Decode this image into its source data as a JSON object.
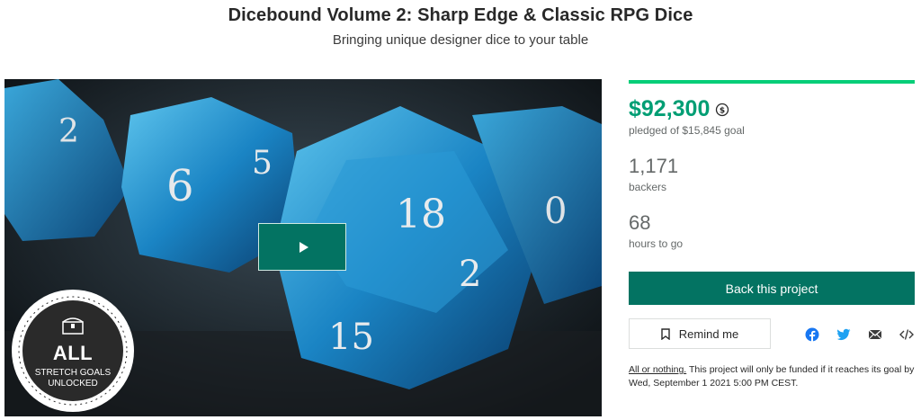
{
  "project": {
    "title": "Dicebound Volume 2: Sharp Edge & Classic RPG Dice",
    "subtitle": "Bringing unique designer dice to your table"
  },
  "media": {
    "play_icon": "play-icon",
    "badge": {
      "line1": "ALL",
      "line2": "STRETCH GOALS",
      "line3": "UNLOCKED",
      "icon": "treasure-chest-icon"
    }
  },
  "funding": {
    "pledged": "$92,300",
    "currency_icon": "currency-convert-icon",
    "goal_text": "pledged of $15,845 goal",
    "progress_fraction": 1.0,
    "progress_color": "#05ce78"
  },
  "stats": {
    "backers_count": "1,171",
    "backers_label": "backers",
    "hours_count": "68",
    "hours_label": "hours to go"
  },
  "actions": {
    "back_label": "Back this project",
    "remind_label": "Remind me",
    "remind_icon": "bookmark-icon",
    "share_icons": [
      "facebook-icon",
      "twitter-icon",
      "email-icon",
      "embed-icon"
    ]
  },
  "notice": {
    "link": "All or nothing.",
    "text": " This project will only be funded if it reaches its goal by Wed, September 1 2021 5:00 PM CEST."
  },
  "colors": {
    "accent_green": "#037362",
    "pledged_green": "#009e74",
    "muted_text": "#656969"
  }
}
